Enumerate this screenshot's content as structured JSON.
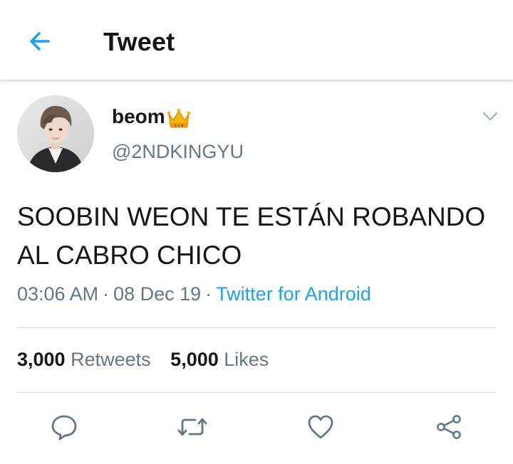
{
  "header": {
    "title": "Tweet",
    "back_icon": "arrow-left-icon",
    "accent_color": "#1da1f2"
  },
  "author": {
    "display_name": "beom",
    "name_emoji": "crown-emoji",
    "handle": "@2NDKINGYU",
    "avatar": "profile-photo"
  },
  "tweet": {
    "text": "SOOBIN WEON TE ESTÁN ROBANDO AL CABRO CHICO",
    "time": "03:06 AM",
    "date": "08 Dec 19",
    "separator": "·",
    "client": "Twitter for Android"
  },
  "stats": {
    "retweets_count": "3,000",
    "retweets_label": "Retweets",
    "likes_count": "5,000",
    "likes_label": "Likes"
  },
  "actions": [
    {
      "icon": "reply-icon"
    },
    {
      "icon": "retweet-icon"
    },
    {
      "icon": "like-icon"
    },
    {
      "icon": "share-icon"
    }
  ]
}
